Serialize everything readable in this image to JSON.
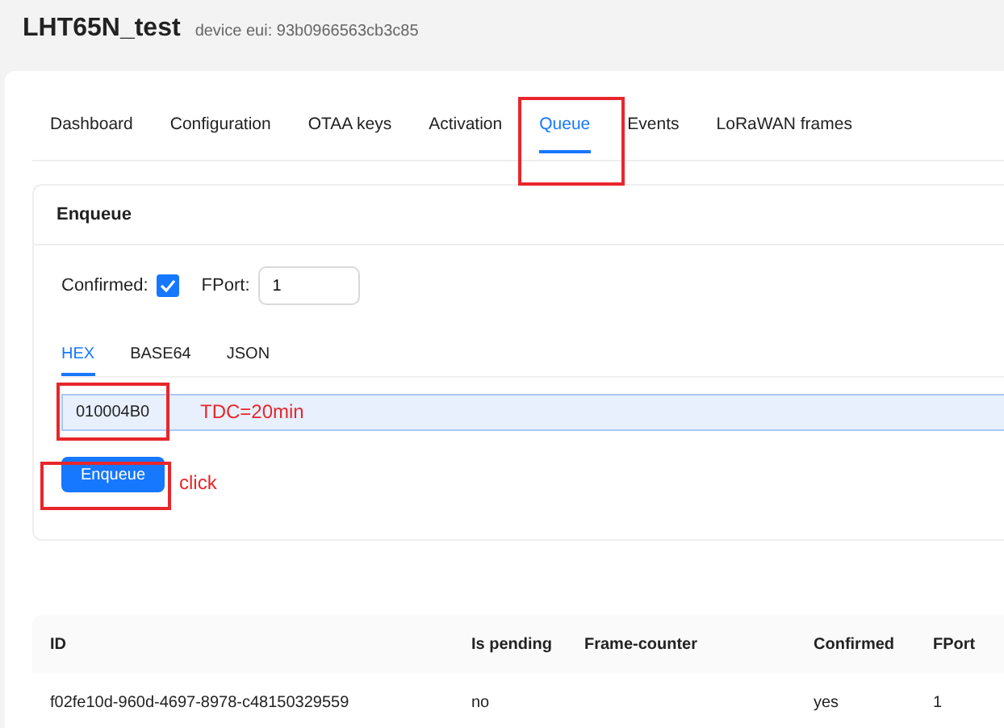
{
  "header": {
    "title": "LHT65N_test",
    "subtitle": "device eui: 93b0966563cb3c85"
  },
  "tabs": [
    {
      "label": "Dashboard",
      "selected": false,
      "highlighted": false
    },
    {
      "label": "Configuration",
      "selected": false,
      "highlighted": false
    },
    {
      "label": "OTAA keys",
      "selected": false,
      "highlighted": false
    },
    {
      "label": "Activation",
      "selected": false,
      "highlighted": false
    },
    {
      "label": "Queue",
      "selected": true,
      "highlighted": true
    },
    {
      "label": "Events",
      "selected": false,
      "highlighted": false
    },
    {
      "label": "LoRaWAN frames",
      "selected": false,
      "highlighted": false
    }
  ],
  "enqueue_card": {
    "title": "Enqueue",
    "confirmed": {
      "label": "Confirmed:",
      "checked": true
    },
    "fport": {
      "label": "FPort:",
      "value": "1"
    },
    "format_tabs": [
      {
        "label": "HEX",
        "selected": true
      },
      {
        "label": "BASE64",
        "selected": false
      },
      {
        "label": "JSON",
        "selected": false
      }
    ],
    "payload": {
      "value": "010004B0",
      "highlighted": true,
      "note": "TDC=20min"
    },
    "button": {
      "label": "Enqueue",
      "highlighted": true,
      "note": "click"
    }
  },
  "queue_table": {
    "columns": [
      "ID",
      "Is pending",
      "Frame-counter",
      "Confirmed",
      "FPort"
    ],
    "rows": [
      [
        "f02fe10d-960d-4697-8978-c48150329559",
        "no",
        "",
        "yes",
        "1"
      ]
    ]
  }
}
